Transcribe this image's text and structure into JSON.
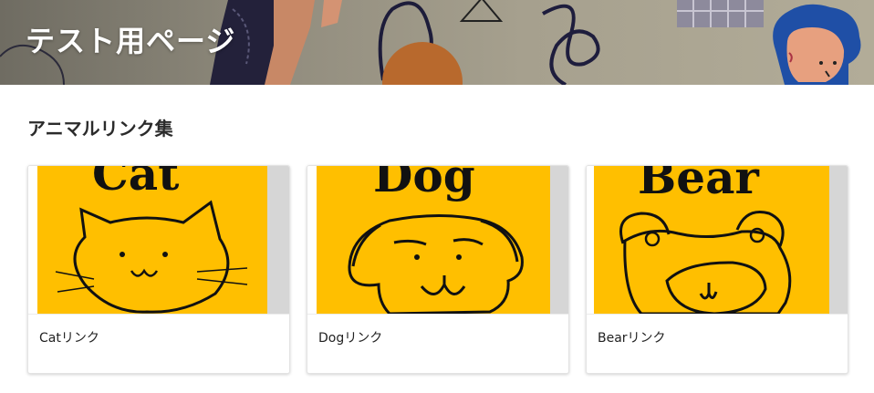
{
  "header": {
    "title": "テスト用ページ"
  },
  "section": {
    "title": "アニマルリンク集"
  },
  "cards": [
    {
      "image_text": "Cat",
      "label": "Catリンク",
      "animal": "cat"
    },
    {
      "image_text": "Dog",
      "label": "Dogリンク",
      "animal": "dog"
    },
    {
      "image_text": "Bear",
      "label": "Bearリンク",
      "animal": "bear"
    }
  ],
  "colors": {
    "card_image_bg": "#ffbf00",
    "text": "#222222"
  }
}
